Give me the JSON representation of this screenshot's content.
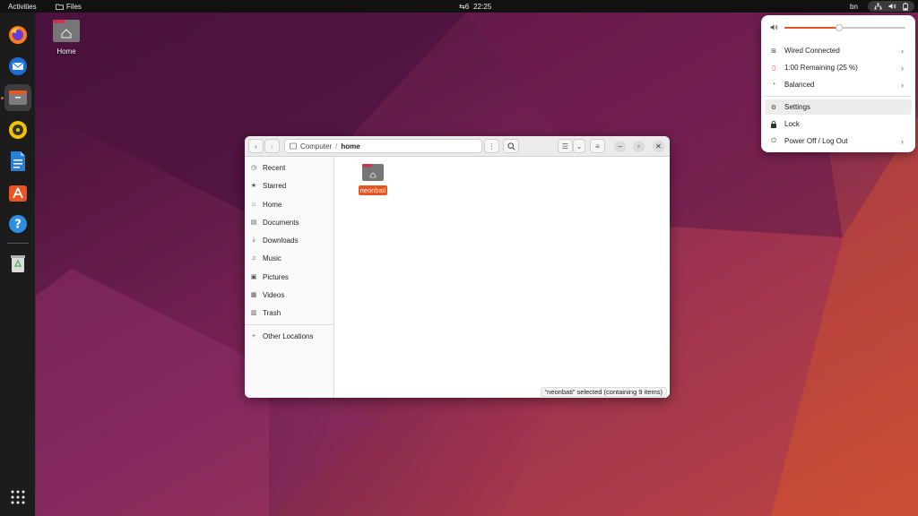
{
  "topbar": {
    "activities": "Activities",
    "app_name": "Files",
    "workspace": "6",
    "time": "22:25",
    "language": "bn"
  },
  "dock": {
    "items": [
      {
        "name": "firefox-icon"
      },
      {
        "name": "thunderbird-icon"
      },
      {
        "name": "files-icon",
        "active": true
      },
      {
        "name": "rhythmbox-icon"
      },
      {
        "name": "libreoffice-writer-icon"
      },
      {
        "name": "software-center-icon"
      },
      {
        "name": "help-icon"
      },
      {
        "name": "trash-icon"
      },
      {
        "name": "show-apps-icon"
      }
    ]
  },
  "desktop": {
    "home_label": "Home"
  },
  "window": {
    "path": {
      "root": "Computer",
      "separator": "/",
      "current": "home"
    },
    "sidebar": {
      "items": [
        {
          "label": "Recent",
          "icon": "clock-icon"
        },
        {
          "label": "Starred",
          "icon": "star-icon"
        },
        {
          "label": "Home",
          "icon": "home-icon"
        },
        {
          "label": "Documents",
          "icon": "document-icon"
        },
        {
          "label": "Downloads",
          "icon": "download-icon"
        },
        {
          "label": "Music",
          "icon": "music-icon"
        },
        {
          "label": "Pictures",
          "icon": "picture-icon"
        },
        {
          "label": "Videos",
          "icon": "video-icon"
        },
        {
          "label": "Trash",
          "icon": "trash-icon"
        }
      ],
      "other": "Other Locations"
    },
    "files": [
      {
        "name": "neonbati",
        "selected": true
      }
    ],
    "status": "“neonbati” selected  (containing 9 items)"
  },
  "sysmenu": {
    "volume_level": 0.45,
    "items": [
      {
        "label": "Wired Connected",
        "icon": "network-icon",
        "chevron": true
      },
      {
        "label": "1:00 Remaining (25 %)",
        "icon": "battery-icon",
        "chevron": true
      },
      {
        "label": "Balanced",
        "icon": "power-profile-icon",
        "chevron": true
      },
      {
        "label": "Settings",
        "icon": "gear-icon",
        "chevron": false,
        "highlighted": true
      },
      {
        "label": "Lock",
        "icon": "lock-icon",
        "chevron": false
      },
      {
        "label": "Power Off / Log Out",
        "icon": "power-icon",
        "chevron": true
      }
    ]
  },
  "colors": {
    "accent": "#e95420",
    "wallpaper_dark": "#4a1538",
    "wallpaper_mid": "#8a2a5e",
    "wallpaper_light": "#c4306a"
  }
}
